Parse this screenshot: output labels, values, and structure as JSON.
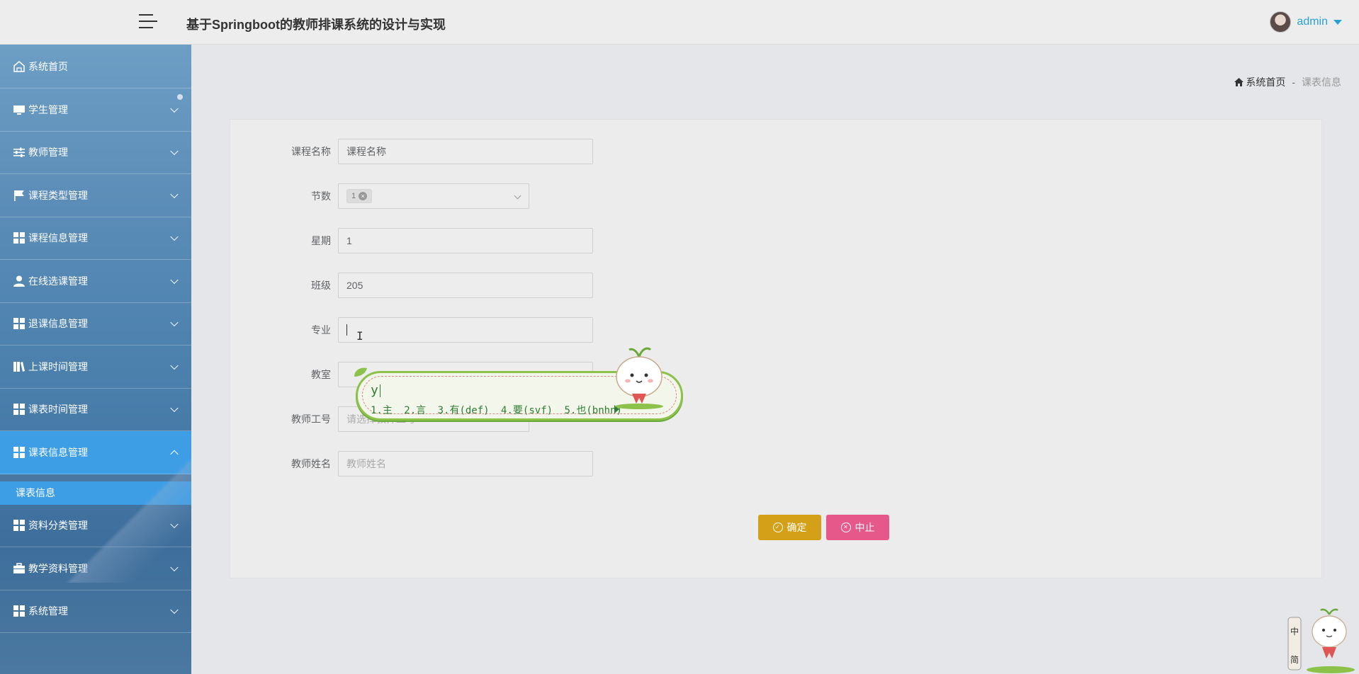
{
  "header": {
    "title": "基于Springboot的教师排课系统的设计与实现",
    "user_name": "admin"
  },
  "sidebar": {
    "items": [
      {
        "label": "系统首页",
        "icon": "home-icon"
      },
      {
        "label": "学生管理",
        "icon": "monitor-icon"
      },
      {
        "label": "教师管理",
        "icon": "sliders-icon"
      },
      {
        "label": "课程类型管理",
        "icon": "flag-icon"
      },
      {
        "label": "课程信息管理",
        "icon": "grid-icon"
      },
      {
        "label": "在线选课管理",
        "icon": "user-icon"
      },
      {
        "label": "退课信息管理",
        "icon": "grid-icon"
      },
      {
        "label": "上课时间管理",
        "icon": "book-icon"
      },
      {
        "label": "课表时间管理",
        "icon": "grid-icon"
      },
      {
        "label": "课表信息管理",
        "icon": "grid-icon",
        "active": true
      },
      {
        "label": "资料分类管理",
        "icon": "grid-icon"
      },
      {
        "label": "教学资料管理",
        "icon": "briefcase-icon"
      },
      {
        "label": "系统管理",
        "icon": "grid-icon"
      }
    ],
    "submenu": {
      "label": "课表信息"
    }
  },
  "breadcrumb": {
    "home": "系统首页",
    "separator": "-",
    "current": "课表信息"
  },
  "form": {
    "course_name": {
      "label": "课程名称",
      "value": "课程名称"
    },
    "periods": {
      "label": "节数",
      "tag": "1"
    },
    "weekday": {
      "label": "星期",
      "value": "1"
    },
    "class": {
      "label": "班级",
      "value": "205"
    },
    "major": {
      "label": "专业",
      "value": ""
    },
    "classroom": {
      "label": "教室",
      "value": ""
    },
    "teacher_id": {
      "label": "教师工号",
      "placeholder": "请选择教师工号"
    },
    "teacher_name": {
      "label": "教师姓名",
      "placeholder": "教师姓名"
    }
  },
  "buttons": {
    "confirm": "确定",
    "stop": "中止"
  },
  "ime": {
    "composition": "y",
    "candidates": [
      "1.主",
      "2.言",
      "3.有(def)",
      "4.要(svf)",
      "5.也(bnhn)"
    ]
  },
  "colors": {
    "active_menu": "#3d9ee6",
    "confirm_button": "#d4a017",
    "stop_button": "#e7588a",
    "user_link": "#2aa2d6"
  }
}
